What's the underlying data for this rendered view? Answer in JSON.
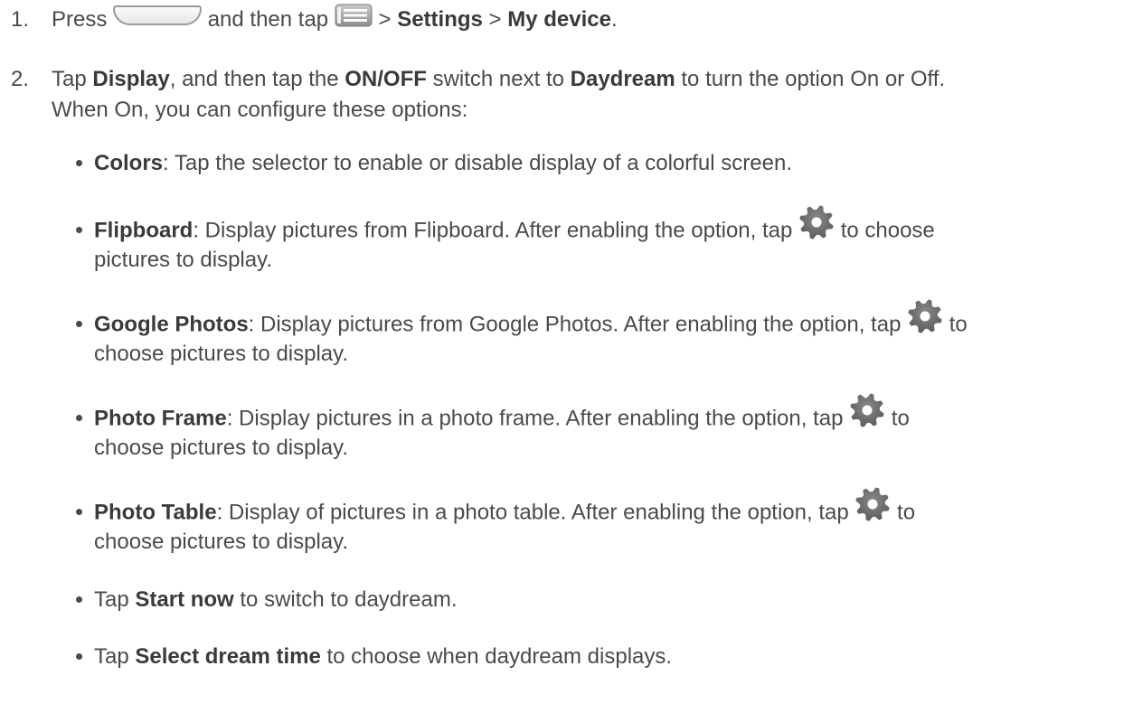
{
  "step1": {
    "number": "1.",
    "press": "Press",
    "and_then_tap": "and then tap",
    "sep1": ">",
    "settings": "Settings",
    "sep2": ">",
    "my_device": "My device",
    "period": "."
  },
  "step2": {
    "number": "2.",
    "tap": "Tap",
    "display": "Display",
    "and_then_tap_the": ", and then tap the",
    "onoff": "ON/OFF",
    "switch_next_to": "switch next to",
    "daydream": "Daydream",
    "rest": "to turn the option On or Off.",
    "line2": "When On, you can configure these options:"
  },
  "bullets": {
    "colors": {
      "term": "Colors",
      "desc": ": Tap the selector to enable or disable display of a colorful screen."
    },
    "flipboard": {
      "term": "Flipboard",
      "desc": ": Display pictures from Flipboard. After enabling the option, tap",
      "after_icon": "to choose",
      "line2": "pictures to display."
    },
    "google_photos": {
      "term": "Google Photos",
      "desc": ": Display pictures from Google Photos. After enabling the option, tap",
      "after_icon": "to",
      "line2": "choose pictures to display."
    },
    "photo_frame": {
      "term": "Photo Frame",
      "desc": ": Display pictures in a photo frame. After enabling the option, tap",
      "after_icon": "to",
      "line2": "choose pictures to display."
    },
    "photo_table": {
      "term": "Photo Table",
      "desc": ": Display of pictures in a photo table. After enabling the option, tap",
      "after_icon": "to",
      "line2": "choose pictures to display."
    },
    "start_now": {
      "pre": "Tap",
      "term": "Start now",
      "desc": "to switch to daydream."
    },
    "select_dream": {
      "pre": "Tap",
      "term": "Select dream time",
      "desc": "to choose when daydream displays."
    }
  },
  "icons": {
    "home_key": "home-key-icon",
    "menu_key": "menu-key-icon",
    "settings_gear": "gear-icon"
  }
}
